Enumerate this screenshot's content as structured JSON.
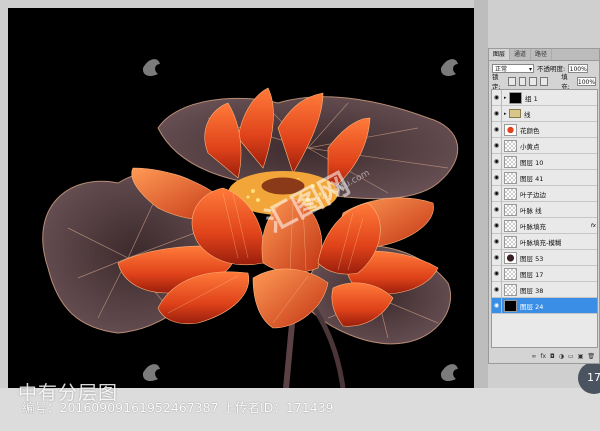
{
  "watermark": {
    "center_text": "汇图网",
    "url_text": "www.huitu.com",
    "overlay_text": "中有分层图",
    "caption": "编号：20160909161952467387 上传者ID：171439"
  },
  "badge": {
    "label": "17"
  },
  "layers_panel": {
    "tabs": [
      "图层",
      "通道",
      "路径"
    ],
    "blend_mode": "正常",
    "opacity_label": "不透明度:",
    "opacity_value": "100%",
    "lock_label": "锁定:",
    "fill_label": "填充:",
    "fill_value": "100%",
    "layers": [
      {
        "name": "组 1",
        "thumb": "mask",
        "folder": true,
        "fx": false,
        "selected": false
      },
      {
        "name": "线",
        "thumb": "folder",
        "folder": true,
        "fx": false,
        "selected": false
      },
      {
        "name": "花颜色",
        "thumb": "flower",
        "folder": false,
        "fx": false,
        "selected": false
      },
      {
        "name": "小黄点",
        "thumb": "checker",
        "folder": false,
        "fx": false,
        "selected": false
      },
      {
        "name": "图层 10",
        "thumb": "checker",
        "folder": false,
        "fx": false,
        "selected": false
      },
      {
        "name": "图层 41",
        "thumb": "checker",
        "folder": false,
        "fx": false,
        "selected": false
      },
      {
        "name": "叶子边边",
        "thumb": "checker",
        "folder": false,
        "fx": false,
        "selected": false
      },
      {
        "name": "叶脉 线",
        "thumb": "checker",
        "folder": false,
        "fx": false,
        "selected": false
      },
      {
        "name": "叶脉填充",
        "thumb": "checker",
        "folder": false,
        "fx": true,
        "selected": false
      },
      {
        "name": "叶脉填充-模糊",
        "thumb": "checker",
        "folder": false,
        "fx": false,
        "selected": false
      },
      {
        "name": "图层 53",
        "thumb": "dark",
        "folder": false,
        "fx": false,
        "selected": false
      },
      {
        "name": "图层 17",
        "thumb": "checker",
        "folder": false,
        "fx": false,
        "selected": false
      },
      {
        "name": "图层 38",
        "thumb": "checker",
        "folder": false,
        "fx": false,
        "selected": false
      },
      {
        "name": "图层 24",
        "thumb": "black",
        "folder": false,
        "fx": false,
        "selected": true
      }
    ],
    "footer_icons": [
      "link-icon",
      "fx-icon",
      "mask-icon",
      "adjustment-icon",
      "group-icon",
      "new-layer-icon",
      "trash-icon"
    ]
  }
}
